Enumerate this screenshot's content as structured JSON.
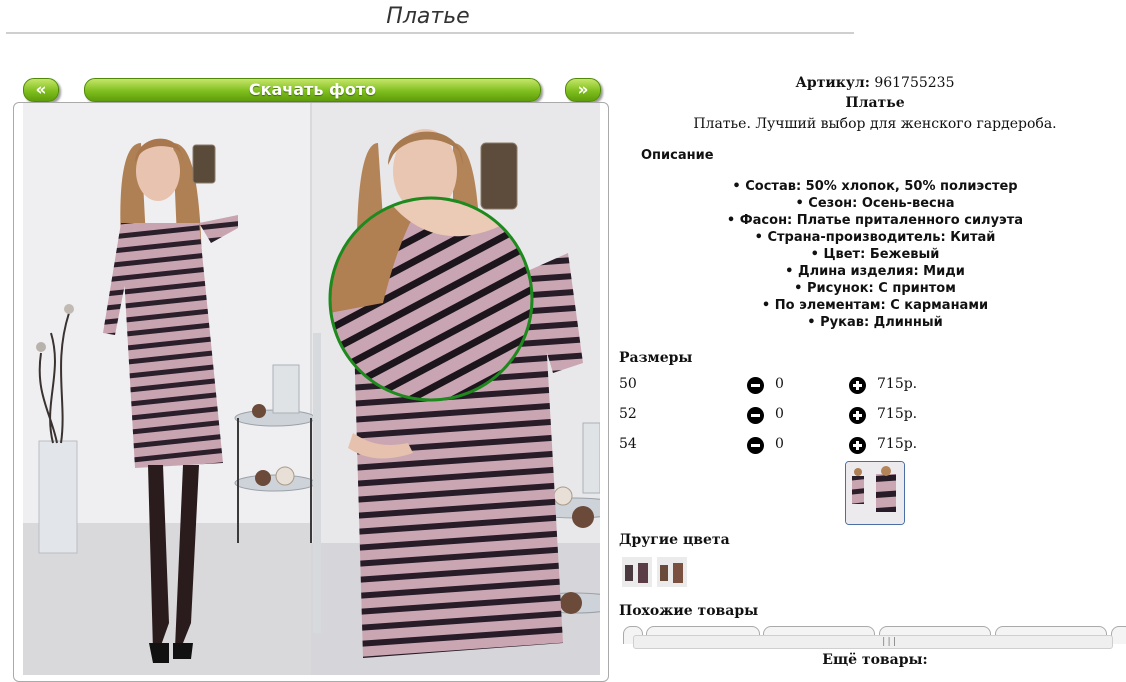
{
  "page": {
    "title": "Платье"
  },
  "gallery": {
    "prev_label": "«",
    "download_label": "Скачать фото",
    "next_label": "»"
  },
  "product": {
    "sku_label": "Артикул:",
    "sku_value": "961755235",
    "name": "Платье",
    "short_description": "Платье. Лучший выбор для женского гардероба.",
    "description_heading": "Описание",
    "attributes": [
      "Состав: 50% хлопок, 50% полиэстер",
      "Сезон: Осень-весна",
      "Фасон: Платье приталенного силуэта",
      "Страна-производитель: Китай",
      "Цвет: Бежевый",
      "Длина изделия: Миди",
      "Рисунок: С принтом",
      "По элементам: С карманами",
      "Рукав: Длинный"
    ]
  },
  "sizes": {
    "heading": "Размеры",
    "rows": [
      {
        "size": "50",
        "qty": "0",
        "price": "715р."
      },
      {
        "size": "52",
        "qty": "0",
        "price": "715р."
      },
      {
        "size": "54",
        "qty": "0",
        "price": "715р."
      }
    ]
  },
  "other_colors": {
    "heading": "Другие цвета"
  },
  "similar": {
    "heading": "Похожие товары",
    "grip": "|||"
  },
  "more_products": {
    "label": "Ещё товары:"
  },
  "colors": {
    "accent_green": "#7fbf1d",
    "dress_stripe": "#2a1f2a",
    "dress_base": "#c8a3b0",
    "zoom_ring": "#1e8a1e"
  },
  "icons": {
    "minus": "minus-circle-icon",
    "plus": "plus-circle-icon"
  }
}
